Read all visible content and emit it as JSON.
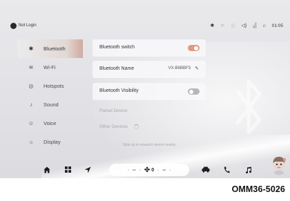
{
  "status_bar": {
    "login_text": "Not Login",
    "icons": [
      "bluetooth-icon",
      "wifi-icon",
      "hotspot-icon",
      "volume-icon",
      "signal-icon",
      "user-voice-icon"
    ],
    "time": "01:05"
  },
  "sidebar": {
    "items": [
      {
        "label": "Bluetooth",
        "icon": "bluetooth-icon",
        "glyph": "✱"
      },
      {
        "label": "Wi-Fi",
        "icon": "wifi-icon",
        "glyph": "≋"
      },
      {
        "label": "Hotspots",
        "icon": "hotspot-icon",
        "glyph": "◎"
      },
      {
        "label": "Sound",
        "icon": "sound-icon",
        "glyph": "♪"
      },
      {
        "label": "Voice",
        "icon": "voice-icon",
        "glyph": "☺"
      },
      {
        "label": "Display",
        "icon": "display-icon",
        "glyph": "☼"
      }
    ],
    "active": "Bluetooth"
  },
  "bluetooth": {
    "switch_label": "Bluetooth switch",
    "switch_on": true,
    "name_label": "Bluetooth Name",
    "name_value": "VX-B6BBF3",
    "visibility_label": "Bluetooth Visibility",
    "visibility_on": false,
    "paired_label": "Paired Device",
    "other_label": "Other Devices",
    "hint": "Slide up to research device nearby"
  },
  "dock": {
    "left_icons": [
      "home-icon",
      "apps-icon",
      "navigation-icon"
    ],
    "right_icons": [
      "car-icon",
      "phone-icon",
      "music-icon"
    ],
    "climate": {
      "left_temp": "--",
      "fan_level": "0",
      "right_temp": "--"
    }
  },
  "caption": "OMM36-5026",
  "colors": {
    "accent": "#e39a7c",
    "background": "#e3e3e6",
    "toggle_off": "#b6b6bc"
  }
}
